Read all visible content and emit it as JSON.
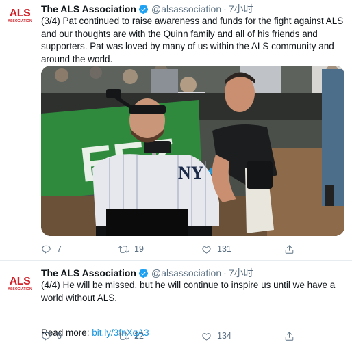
{
  "tweets": [
    {
      "avatar": {
        "logo": "ALS",
        "sub": "ASSOCIATION"
      },
      "name": "The ALS Association",
      "handle": "@alsassociation",
      "separator": "·",
      "time": "7小时",
      "text": "(3/4) Pat continued to raise awareness and funds for the fight against ALS and our thoughts are with the Quinn family and all of his friends and supporters. Pat was loved by many of us within the ALS community and around the world.",
      "media": "photo-pat-quinn-at-baseball-stadium",
      "replies": "7",
      "retweets": "19",
      "likes": "131"
    },
    {
      "avatar": {
        "logo": "ALS",
        "sub": "ASSOCIATION"
      },
      "name": "The ALS Association",
      "handle": "@alsassociation",
      "separator": "·",
      "time": "7小时",
      "text": "(4/4) He will be missed, but he will continue to inspire us until we have a world without ALS.",
      "read_more_label": "Read more: ",
      "read_more_link": "bit.ly/3fnXqA3",
      "replies": "6",
      "retweets": "22",
      "likes": "134"
    }
  ],
  "colors": {
    "link": "#1b95e0",
    "secondary": "#5b7083",
    "verified": "#1da1f2",
    "brand_red": "#d2232a"
  }
}
